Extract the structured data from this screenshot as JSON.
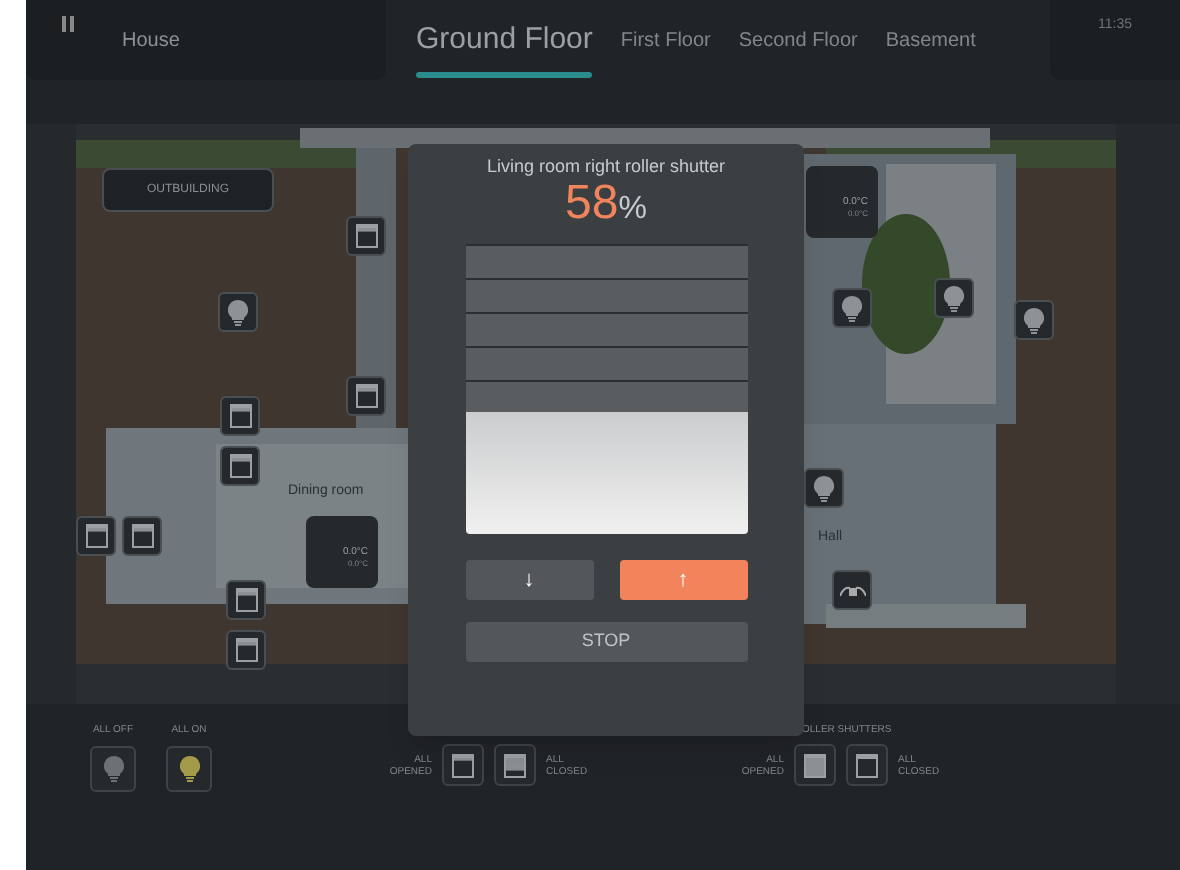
{
  "top_bar": {
    "house": "House",
    "tabs": [
      {
        "label": "Ground Floor",
        "selected": true
      },
      {
        "label": "First Floor",
        "selected": false
      },
      {
        "label": "Second Floor",
        "selected": false
      },
      {
        "label": "Basement",
        "selected": false
      }
    ],
    "time": "11:35"
  },
  "plan": {
    "outbuilding": "OUTBUILDING",
    "rooms": [
      {
        "label": "Dining room"
      },
      {
        "label": "Hall"
      }
    ],
    "thermostats": [
      {
        "reading": "0.0°C",
        "sub": "0.0°C"
      },
      {
        "reading": "0.0°C",
        "sub": "0.0°C"
      }
    ],
    "devices": [
      {
        "kind": "shutter"
      },
      {
        "kind": "light"
      },
      {
        "kind": "shutter"
      },
      {
        "kind": "shutter"
      },
      {
        "kind": "shutter"
      },
      {
        "kind": "shutter"
      },
      {
        "kind": "shutter"
      },
      {
        "kind": "shutter"
      },
      {
        "kind": "shutter"
      },
      {
        "kind": "light"
      },
      {
        "kind": "light"
      },
      {
        "kind": "light"
      },
      {
        "kind": "light"
      },
      {
        "kind": "gate"
      }
    ]
  },
  "dialog": {
    "title": "Living room right roller shutter",
    "value": "58",
    "unit": "%",
    "level": 0.58,
    "buttons": [
      {
        "symbol": "↓",
        "selected": false
      },
      {
        "symbol": "↑",
        "selected": true
      }
    ],
    "stop": "STOP"
  },
  "bottom": {
    "lights": [
      {
        "label": "ALL OFF",
        "on": false
      },
      {
        "label": "ALL ON",
        "on": true
      }
    ],
    "groups": [
      {
        "opened": "ALL OPENED",
        "closed": "ALL CLOSED",
        "kind": "blind"
      },
      {
        "title": "OLLER SHUTTERS",
        "opened": "ALL OPENED",
        "closed": "ALL CLOSED",
        "kind": "shutter"
      }
    ]
  }
}
